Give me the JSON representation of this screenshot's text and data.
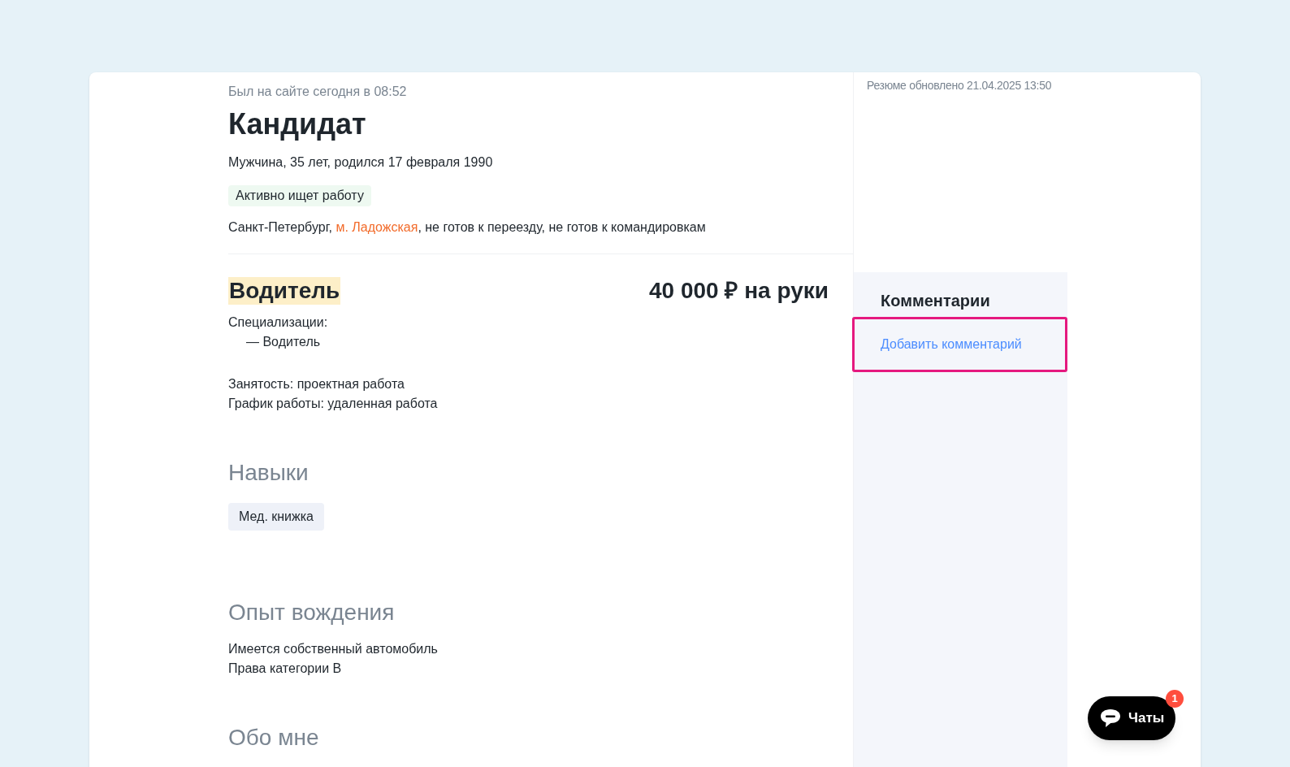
{
  "last_seen": "Был на сайте сегодня в 08:52",
  "name": "Кандидат",
  "personal": "Мужчина, 35 лет, родился 17 февраля 1990",
  "job_search_status": "Активно ищет работу",
  "location": {
    "city": "Санкт-Петербург, ",
    "metro": "м. Ладожская",
    "rest": ", не готов к переезду, не готов к командировкам"
  },
  "position": {
    "title": "Водитель",
    "salary": "40 000 ₽ на руки"
  },
  "specializations": {
    "label": "Специализации:",
    "items": [
      "— Водитель"
    ]
  },
  "employment": "Занятость: проектная работа",
  "schedule": "График работы: удаленная работа",
  "skills": {
    "heading": "Навыки",
    "tags": [
      "Мед. книжка"
    ]
  },
  "driving": {
    "heading": "Опыт вождения",
    "lines": [
      "Имеется собственный автомобиль",
      "Права категории B"
    ]
  },
  "about": {
    "heading": "Обо мне"
  },
  "resume_updated": "Резюме обновлено 21.04.2025 13:50",
  "comments": {
    "heading": "Комментарии",
    "add_link": "Добавить комментарий",
    "highlighted": true
  },
  "chat_button": {
    "label": "Чаты",
    "badge": "1"
  }
}
